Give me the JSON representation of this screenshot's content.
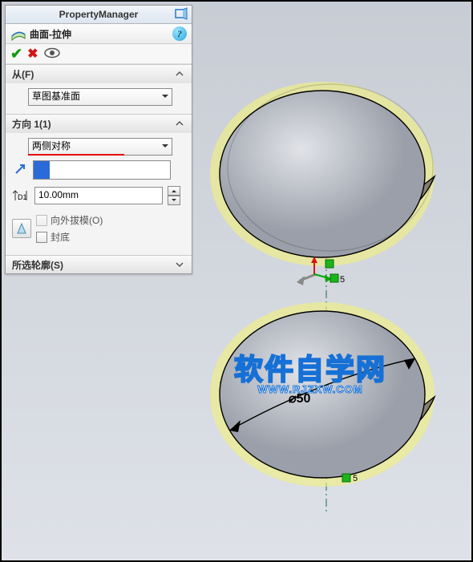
{
  "panel": {
    "title": "PropertyManager",
    "featureTitle": "曲面-拉伸",
    "from": {
      "header": "从(F)",
      "option": "草图基准面"
    },
    "direction1": {
      "header": "方向 1(1)",
      "endCondition": "两侧对称",
      "depth": "10.00mm",
      "draftOutward": "向外拔模(O)",
      "capEnd": "封底"
    },
    "selectedContours": {
      "header": "所选轮廓(S)"
    }
  },
  "viewport": {
    "dimensionLabel": "⌀50",
    "handleLabel1": "5",
    "handleLabel2": "5"
  },
  "watermark": {
    "line1": "软件自学网",
    "line2": "WWW.RJZXW.COM"
  }
}
